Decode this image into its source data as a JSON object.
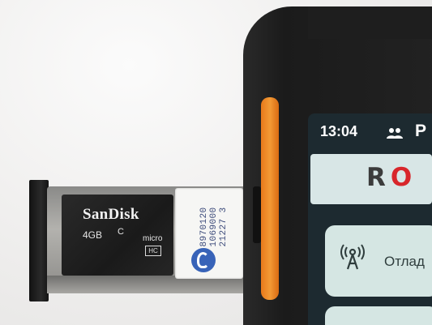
{
  "tray": {
    "sd_card": {
      "brand": "SanDisk",
      "capacity": "4GB",
      "speed_class": "C",
      "micro_label": "micro",
      "hc_label": "HC"
    },
    "sim_card": {
      "number_lines": [
        "8970120",
        "1069000",
        "21227 3"
      ],
      "logo_icon": "sim-operator-logo-icon"
    }
  },
  "phone": {
    "status_bar": {
      "time": "13:04",
      "people_icon": "people-icon",
      "partial_char": "P"
    },
    "app": {
      "logo_text_prefix": "R",
      "logo_text_o": "O",
      "menu_item": {
        "icon": "antenna-signal-icon",
        "label": "Отлад"
      }
    }
  },
  "colors": {
    "phone_accent": "#f39a35",
    "screen_bg": "#1d2a30",
    "button_bg": "#d5e6e3",
    "logo_red": "#d8262b"
  }
}
